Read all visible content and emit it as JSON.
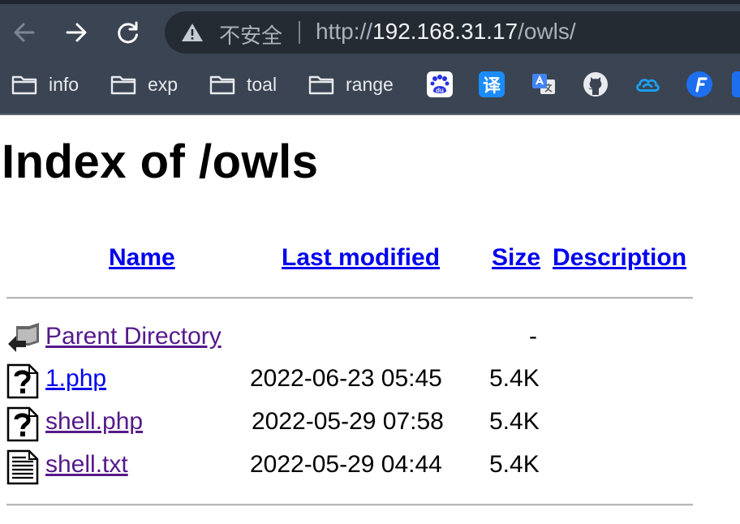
{
  "browser": {
    "security_label": "不安全",
    "url_scheme": "http://",
    "url_host": "192.168.31.17",
    "url_path": "/owls/",
    "bookmarks": [
      {
        "label": "info",
        "icon": "folder-icon"
      },
      {
        "label": "exp",
        "icon": "folder-icon"
      },
      {
        "label": "toal",
        "icon": "folder-icon"
      },
      {
        "label": "range",
        "icon": "folder-icon"
      }
    ],
    "bookmark_icons": [
      "baidu-icon",
      "translate-icon",
      "google-translate-icon",
      "github-icon",
      "cloud-icon",
      "f-app-icon"
    ],
    "translate_char": "译",
    "baidu_text": "du"
  },
  "page": {
    "title": "Index of /owls",
    "columns": {
      "name": "Name",
      "last_modified": "Last modified",
      "size": "Size",
      "description": "Description"
    },
    "rows": [
      {
        "name": "Parent Directory",
        "date": "",
        "size": "-",
        "icon": "back-folder-icon"
      },
      {
        "name": "1.php",
        "date": "2022-06-23 05:45",
        "size": "5.4K",
        "icon": "unknown-file-icon"
      },
      {
        "name": "shell.php",
        "date": "2022-05-29 07:58",
        "size": "5.4K",
        "icon": "unknown-file-icon"
      },
      {
        "name": "shell.txt",
        "date": "2022-05-29 04:44",
        "size": "5.4K",
        "icon": "text-file-icon"
      }
    ]
  },
  "colors": {
    "chrome_bg": "#3a4452",
    "link": "#0000ee",
    "visited_link": "#551a8b"
  }
}
